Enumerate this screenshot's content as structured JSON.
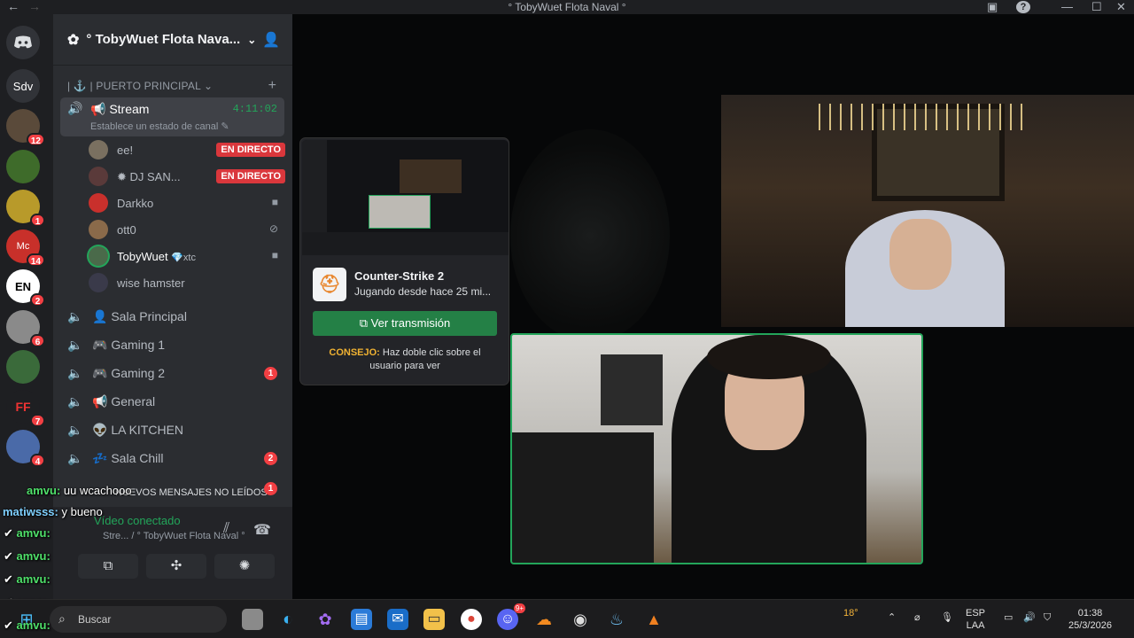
{
  "window": {
    "title": "° TobyWuet Flota Naval °"
  },
  "titlebar": {
    "back": "←",
    "forward": "→",
    "inbox_icon": "inbox-icon",
    "help_icon": "help-icon",
    "min": "—",
    "max": "☐",
    "close": "✕"
  },
  "servers": {
    "home_label": "",
    "items": [
      {
        "label": "Sdv",
        "badge": ""
      },
      {
        "label": "",
        "badge": "12"
      },
      {
        "label": "",
        "badge": ""
      },
      {
        "label": "",
        "badge": "1"
      },
      {
        "label": "Mc",
        "badge": "14"
      },
      {
        "label": "EN",
        "badge": "2"
      },
      {
        "label": "",
        "badge": "6"
      },
      {
        "label": "",
        "badge": ""
      },
      {
        "label": "FF",
        "badge": "7"
      },
      {
        "label": "",
        "badge": "4"
      }
    ]
  },
  "server": {
    "name": "° TobyWuet Flota Nava..."
  },
  "category": {
    "name": "| ⚓ | PUERTO PRINCIPAL"
  },
  "stream_channel": {
    "name": "Stream",
    "time": "4:11:02",
    "status": "Establece un estado de canal"
  },
  "voice_users": [
    {
      "name": "ee!",
      "live": "EN DIRECTO"
    },
    {
      "name": "DJ SAN...",
      "live": "EN DIRECTO"
    },
    {
      "name": "Darkko",
      "live": ""
    },
    {
      "name": "ott0",
      "live": ""
    },
    {
      "name": "TobyWuet",
      "tag": "xtc",
      "live": ""
    },
    {
      "name": "wise hamster",
      "live": ""
    }
  ],
  "channels": [
    {
      "name": "Sala Principal",
      "count": ""
    },
    {
      "name": "Gaming 1",
      "count": ""
    },
    {
      "name": "Gaming 2",
      "count": "1"
    },
    {
      "name": "General",
      "count": ""
    },
    {
      "name": "LA KITCHEN",
      "count": ""
    },
    {
      "name": "Sala Chill",
      "count": "2"
    }
  ],
  "unread": {
    "label": "NUEVOS MENSAJES NO LEÍDOS",
    "count": "1"
  },
  "voice_panel": {
    "status": "Vídeo conectado",
    "path": "Stre... / ° TobyWuet Flota Naval °"
  },
  "chat": [
    {
      "user": "amvu:",
      "text": "uu wcachooo"
    },
    {
      "user": "matiwsss:",
      "text": "y bueno"
    },
    {
      "user": "amvu:",
      "text": ""
    },
    {
      "user": "amvu:",
      "text": ""
    },
    {
      "user": "amvu:",
      "text": ""
    },
    {
      "user": "amvu:",
      "text": ""
    },
    {
      "user": "amvu:",
      "text": ""
    }
  ],
  "popup": {
    "game": "Counter-Strike 2",
    "since": "Jugando desde hace 25 mi...",
    "watch": "Ver transmisión",
    "tip_label": "CONSEJO:",
    "tip_text": "Haz doble clic sobre el usuario para ver"
  },
  "taskbar": {
    "search": "Buscar",
    "weather": "18°",
    "lang1": "ESP",
    "lang2": "LAA",
    "time": "01:38",
    "date": "25/3/2026",
    "discord_badge": "9+"
  }
}
